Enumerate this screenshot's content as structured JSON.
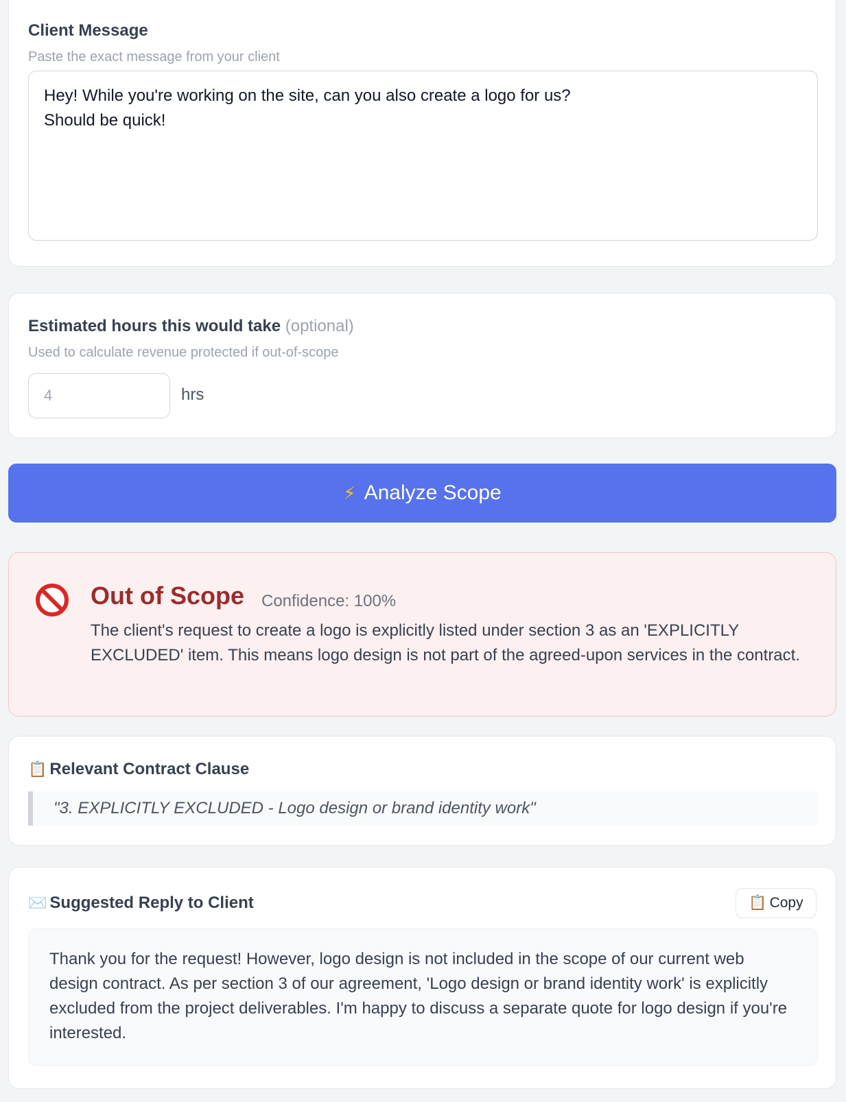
{
  "client_message": {
    "label": "Client Message",
    "hint": "Paste the exact message from your client",
    "value": "Hey! While you're working on the site, can you also create a logo for us?\nShould be quick!"
  },
  "hours": {
    "label": "Estimated hours this would take",
    "optional": "(optional)",
    "hint": "Used to calculate revenue protected if out-of-scope",
    "placeholder": "4",
    "unit": "hrs"
  },
  "analyze_button": {
    "icon": "lightning-icon",
    "label": "Analyze Scope"
  },
  "result": {
    "icon": "prohibited-icon",
    "verdict": "Out of Scope",
    "confidence": "Confidence: 100%",
    "explanation": "The client's request to create a logo is explicitly listed under section 3 as an 'EXPLICITLY EXCLUDED' item. This means logo design is not part of the agreed-upon services in the contract.",
    "colors": {
      "background": "#fdf0f0",
      "title": "#9b2c2c",
      "border": "#f5c6c6"
    }
  },
  "clause": {
    "icon": "clipboard-icon",
    "title": "Relevant Contract Clause",
    "quote": "\"3. EXPLICITLY EXCLUDED - Logo design or brand identity work\""
  },
  "reply": {
    "icon": "envelope-icon",
    "title": "Suggested Reply to Client",
    "copy_label": "Copy",
    "copy_icon": "clipboard-icon",
    "text": "Thank you for the request! However, logo design is not included in the scope of our current web design contract. As per section 3 of our agreement, 'Logo design or brand identity work' is explicitly excluded from the project deliverables. I'm happy to discuss a separate quote for logo design if you're interested."
  },
  "colors": {
    "accent": "#5672ec"
  }
}
